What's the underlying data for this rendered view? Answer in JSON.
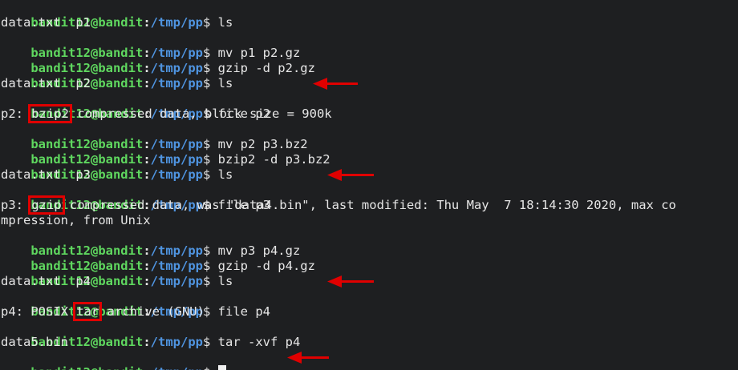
{
  "prompt": {
    "user_host": "bandit12@bandit",
    "colon": ":",
    "path": "/tmp/pp",
    "dollar": "$ "
  },
  "lines": [
    {
      "cmd": "ls"
    },
    {
      "out": "data.txt  p1"
    },
    {
      "cmd": "mv p1 p2.gz"
    },
    {
      "cmd": "gzip -d p2.gz"
    },
    {
      "cmd": "ls"
    },
    {
      "out": "data.txt  p2"
    },
    {
      "cmd": "file p2"
    },
    {
      "out_pre": "p2: ",
      "out_hl": "bzip2",
      "out_post": " compressed data, block size = 900k"
    },
    {
      "cmd": "mv p2 p3.bz2"
    },
    {
      "cmd": "bzip2 -d p3.bz2"
    },
    {
      "cmd": "ls"
    },
    {
      "out": "data.txt  p3"
    },
    {
      "cmd": "file p3"
    },
    {
      "out_pre": "p3: ",
      "out_hl": "gzip",
      "out_post": " compressed data, was \"data4.bin\", last modified: Thu May  7 18:14:30 2020, max co"
    },
    {
      "out": "mpression, from Unix"
    },
    {
      "cmd": "mv p3 p4.gz"
    },
    {
      "cmd": "gzip -d p4.gz"
    },
    {
      "cmd": "ls"
    },
    {
      "out": "data.txt  p4"
    },
    {
      "cmd": "file p4"
    },
    {
      "out_pre": "p4: POSIX ",
      "out_hl": "tar",
      "out_post": " archive (GNU)"
    },
    {
      "cmd": "tar -xvf p4"
    },
    {
      "out": "data5.bin"
    },
    {
      "cmd": ""
    }
  ],
  "colors": {
    "user": "#5fd75f",
    "path": "#4f94e0",
    "highlight": "#e00000",
    "arrow": "#e00000",
    "background": "#1e1f21"
  }
}
